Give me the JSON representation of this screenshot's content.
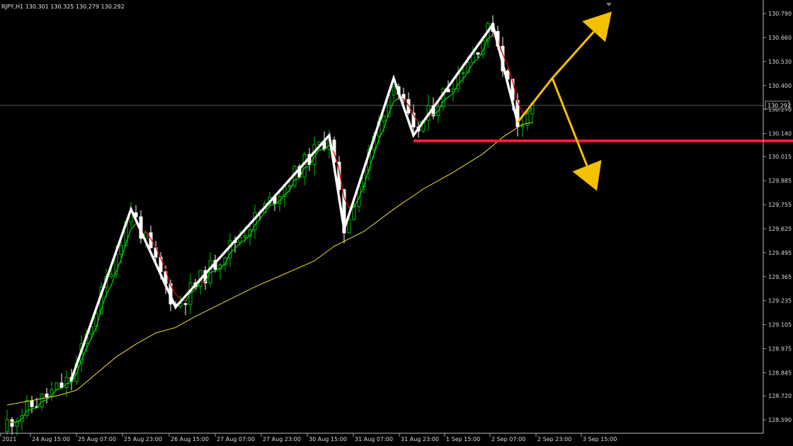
{
  "header": {
    "text": "RJPY,H1  130.301 130.325 130.279 130.292"
  },
  "current_price_label": "130.292",
  "colors": {
    "background": "#000000",
    "bull_candle": "#00c000",
    "bear_candle": "#ffffff",
    "fast_ma_up": "#00d000",
    "fast_ma_down": "#e00000",
    "slow_ma": "#f0e030",
    "zigzag": "#ffffff",
    "support_line": "#ff1a3c",
    "arrows": "#f5c000",
    "current_price_line": "#9a9a9a"
  },
  "chart_data": {
    "type": "candlestick",
    "symbol_timeframe": "H1",
    "yaxis_ticks": [
      "130.790",
      "130.660",
      "130.530",
      "130.400",
      "130.270",
      "130.140",
      "130.015",
      "129.885",
      "129.755",
      "129.625",
      "129.495",
      "129.365",
      "129.235",
      "129.105",
      "128.975",
      "128.845",
      "128.720",
      "128.590"
    ],
    "xaxis_ticks": [
      "2021",
      "24 Aug 15:00",
      "25 Aug 07:00",
      "25 Aug 23:00",
      "26 Aug 15:00",
      "27 Aug 07:00",
      "27 Aug 23:00",
      "30 Aug 15:00",
      "31 Aug 07:00",
      "31 Aug 23:00",
      "1 Sep 15:00",
      "2 Sep 07:00",
      "2 Sep 23:00",
      "3 Sep 15:00"
    ],
    "ylim": [
      128.56,
      130.82
    ],
    "current_price": 130.292,
    "ohlc_last": {
      "open": 130.301,
      "high": 130.325,
      "low": 130.279,
      "close": 130.292
    },
    "zigzag": [
      {
        "bar": 13,
        "price": 128.81
      },
      {
        "bar": 25,
        "price": 129.73
      },
      {
        "bar": 34,
        "price": 129.2
      },
      {
        "bar": 65,
        "price": 130.13
      },
      {
        "bar": 68,
        "price": 129.62
      },
      {
        "bar": 78,
        "price": 130.44
      },
      {
        "bar": 82,
        "price": 130.13
      },
      {
        "bar": 98,
        "price": 130.73
      },
      {
        "bar": 103,
        "price": 130.2
      }
    ],
    "support_level": 130.1,
    "scenario_arrows": [
      {
        "direction": "up",
        "from_bar": 110,
        "from_price": 130.44,
        "to_bar": 122,
        "to_price": 130.8
      },
      {
        "direction": "down",
        "from_bar": 110,
        "from_price": 130.44,
        "to_bar": 119,
        "to_price": 129.83
      }
    ],
    "slow_ma": [
      {
        "bar": 0,
        "price": 128.67
      },
      {
        "bar": 10,
        "price": 128.72
      },
      {
        "bar": 14,
        "price": 128.75
      },
      {
        "bar": 18,
        "price": 128.84
      },
      {
        "bar": 22,
        "price": 128.93
      },
      {
        "bar": 26,
        "price": 129.0
      },
      {
        "bar": 30,
        "price": 129.06
      },
      {
        "bar": 34,
        "price": 129.09
      },
      {
        "bar": 38,
        "price": 129.15
      },
      {
        "bar": 44,
        "price": 129.23
      },
      {
        "bar": 50,
        "price": 129.31
      },
      {
        "bar": 56,
        "price": 129.38
      },
      {
        "bar": 62,
        "price": 129.45
      },
      {
        "bar": 66,
        "price": 129.53
      },
      {
        "bar": 72,
        "price": 129.61
      },
      {
        "bar": 78,
        "price": 129.73
      },
      {
        "bar": 84,
        "price": 129.84
      },
      {
        "bar": 90,
        "price": 129.93
      },
      {
        "bar": 96,
        "price": 130.03
      },
      {
        "bar": 100,
        "price": 130.12
      },
      {
        "bar": 104,
        "price": 130.19
      },
      {
        "bar": 106,
        "price": 130.2
      }
    ]
  }
}
